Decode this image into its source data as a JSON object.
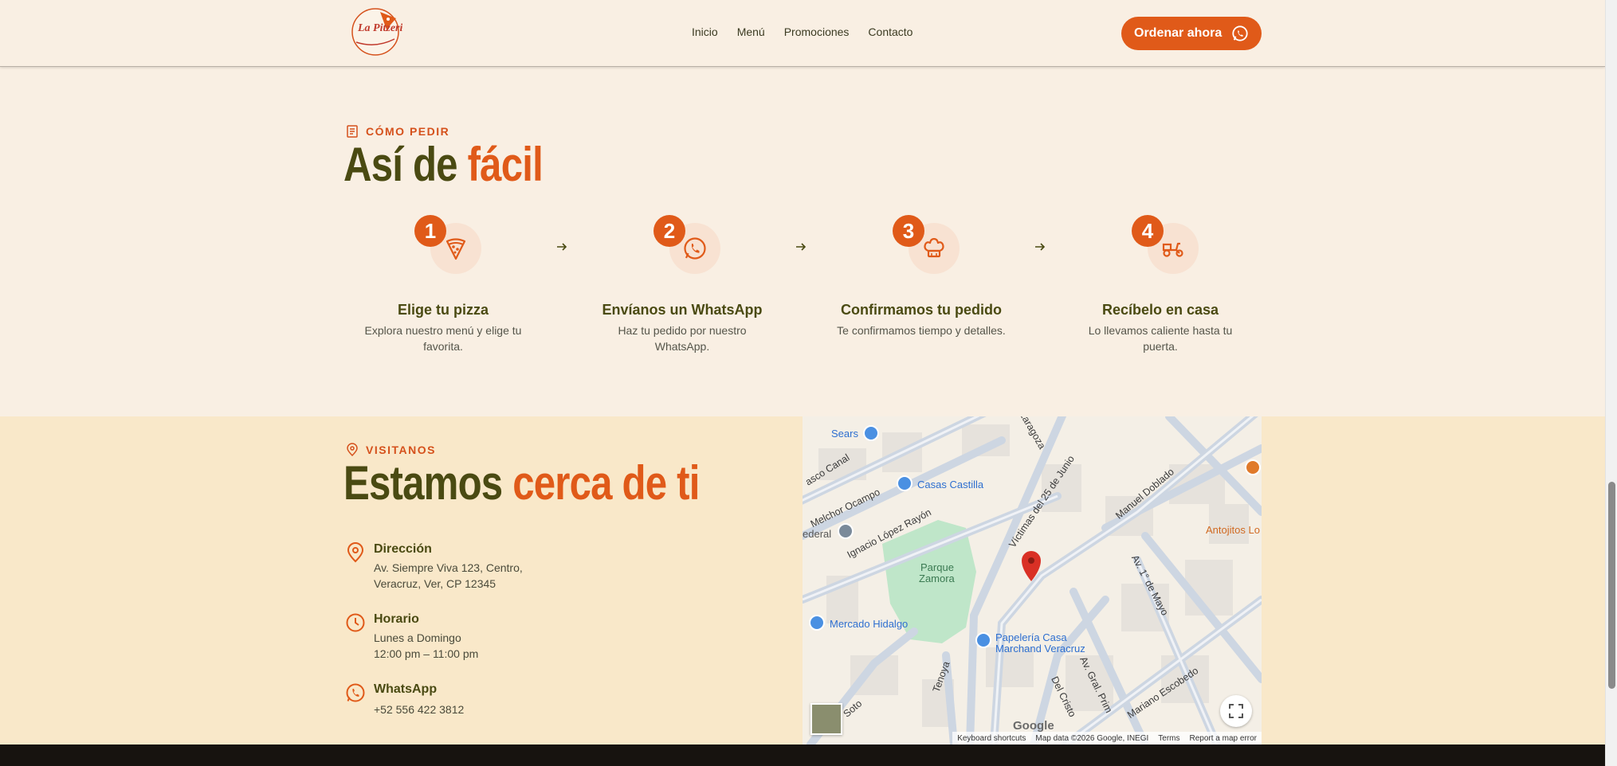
{
  "header": {
    "logo_text": "La Pitzeria",
    "nav": [
      "Inicio",
      "Menú",
      "Promociones",
      "Contacto"
    ],
    "order_button": "Ordenar ahora"
  },
  "how": {
    "eyebrow": "CÓMO PEDIR",
    "title_a": "Así de",
    "title_b": "fácil",
    "steps": [
      {
        "num": "1",
        "icon": "pizza-icon",
        "title": "Elige tu pizza",
        "desc": "Explora nuestro menú y elige tu favorita."
      },
      {
        "num": "2",
        "icon": "whatsapp-icon",
        "title": "Envíanos un WhatsApp",
        "desc": "Haz tu pedido por nuestro WhatsApp."
      },
      {
        "num": "3",
        "icon": "chef-hat-icon",
        "title": "Confirmamos tu pedido",
        "desc": "Te confirmamos tiempo y detalles."
      },
      {
        "num": "4",
        "icon": "scooter-icon",
        "title": "Recíbelo en casa",
        "desc": "Lo llevamos caliente hasta tu puerta."
      }
    ]
  },
  "visit": {
    "eyebrow": "VISITANOS",
    "title_a": "Estamos",
    "title_b": "cerca de ti",
    "address_label": "Dirección",
    "address_line1": "Av. Siempre Viva 123, Centro,",
    "address_line2": "Veracruz, Ver, CP 12345",
    "hours_label": "Horario",
    "hours_line1": "Lunes a Domingo",
    "hours_line2": "12:00 pm – 11:00 pm",
    "whatsapp_label": "WhatsApp",
    "whatsapp_number": "+52 556 422 3812"
  },
  "map": {
    "places": {
      "sears": "Sears",
      "casas_castilla": "Casas Castilla",
      "parque": "Parque",
      "zamora": "Zamora",
      "mercado": "Mercado Hidalgo",
      "papeleria_1": "Papelería Casa",
      "papeleria_2": "Marchand Veracruz",
      "antojitos": "Antojitos Lo",
      "federal": "ederal"
    },
    "streets": {
      "canal": "asco Canal",
      "ocampo": "Melchor Ocampo",
      "rayon": "Ignacio López Rayón",
      "junio": "Víctimas del 25 de Junio",
      "doblado": "Manuel Doblado",
      "mayo": "Av. 1° de Mayo",
      "escobedo": "Mariano Escobedo",
      "prim": "Av. Gral. Prim",
      "cristo": "Del Cristo",
      "tenoya": "Tenoya",
      "soto": "Soto",
      "zaragoza": "Zaragoza"
    },
    "google": "Google",
    "footer": [
      "Keyboard shortcuts",
      "Map data ©2026 Google, INEGI",
      "Terms",
      "Report a map error"
    ]
  },
  "colors": {
    "accent": "#e05a19",
    "olive": "#4a4a12",
    "cream": "#f9efe3",
    "sand": "#f9e8c9"
  }
}
